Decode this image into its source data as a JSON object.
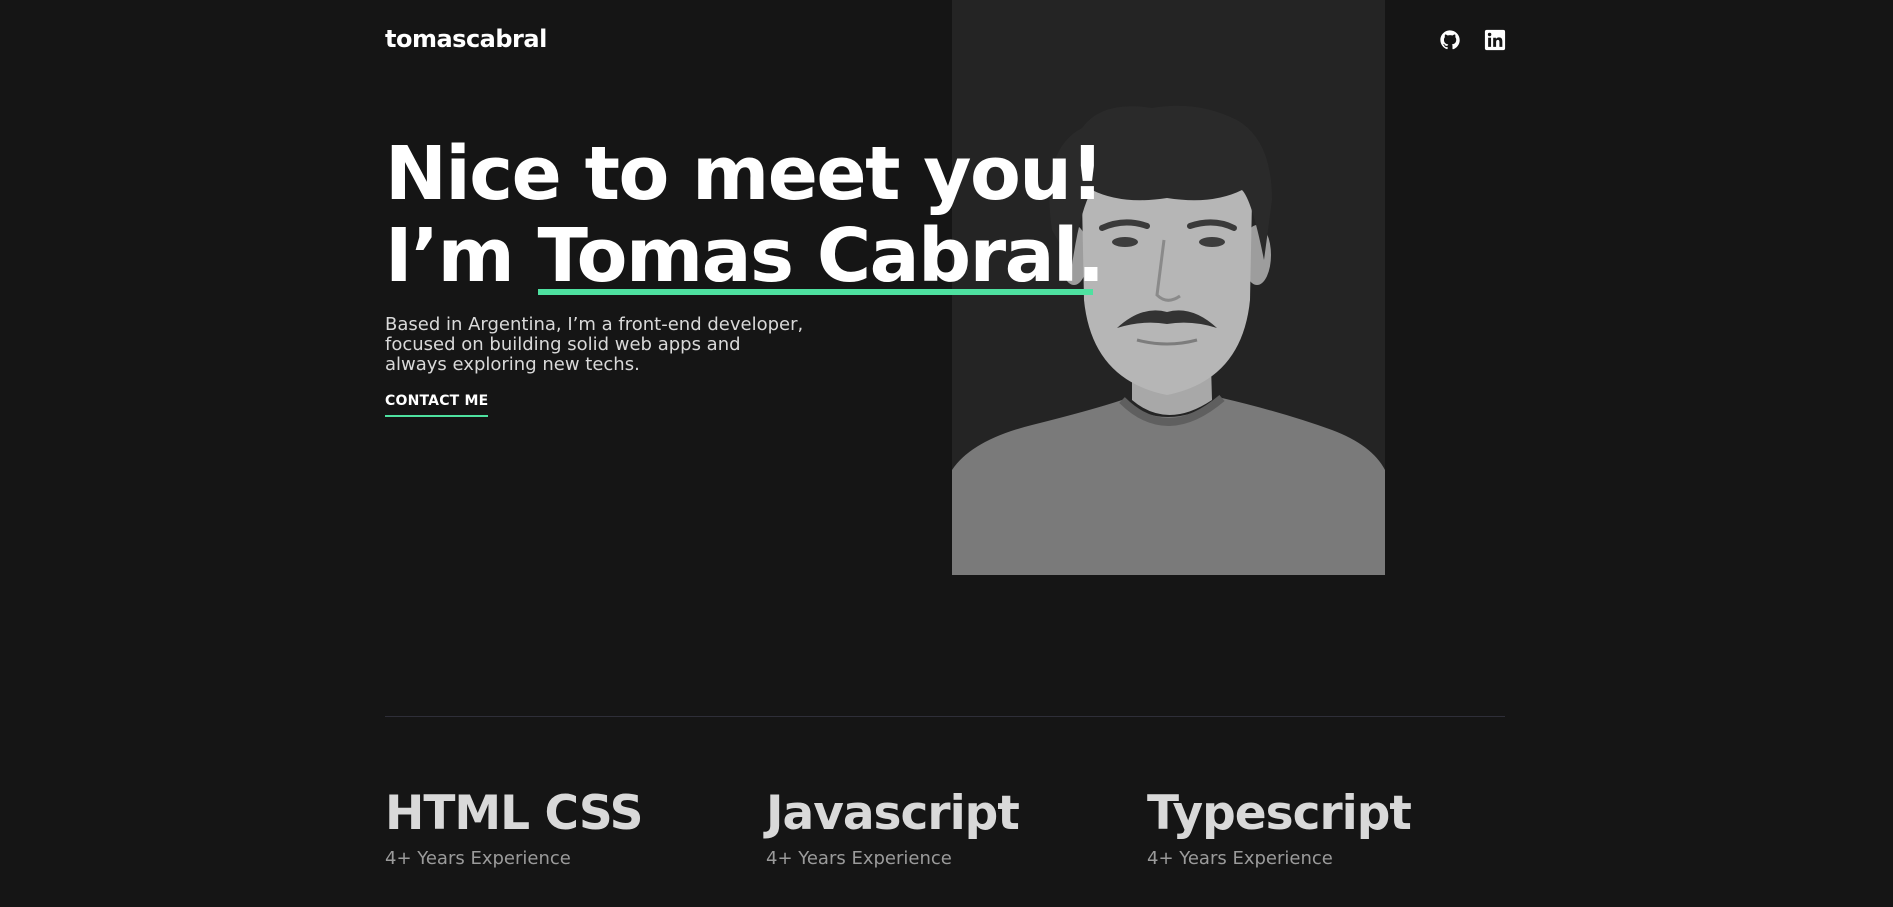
{
  "header": {
    "logo": "tomascabral",
    "social": [
      {
        "icon": "github-icon"
      },
      {
        "icon": "linkedin-icon"
      }
    ]
  },
  "hero": {
    "line1": "Nice to meet you!",
    "line2_prefix": "I’m ",
    "name": "Tomas Cabral.",
    "intro": "Based in Argentina, I’m a front-end developer, focused on building solid web apps and always exploring new techs.",
    "contact_label": "CONTACT ME"
  },
  "skills": [
    {
      "title": "HTML CSS",
      "experience": "4+ Years Experience"
    },
    {
      "title": "Javascript",
      "experience": "4+ Years Experience"
    },
    {
      "title": "Typescript",
      "experience": "4+ Years Experience"
    }
  ],
  "colors": {
    "background": "#151515",
    "accent": "#4ee1a0",
    "photo_panel": "#242424",
    "text_primary": "#ffffff",
    "text_secondary": "#d9d9d9",
    "text_muted": "#9b9b9b"
  }
}
